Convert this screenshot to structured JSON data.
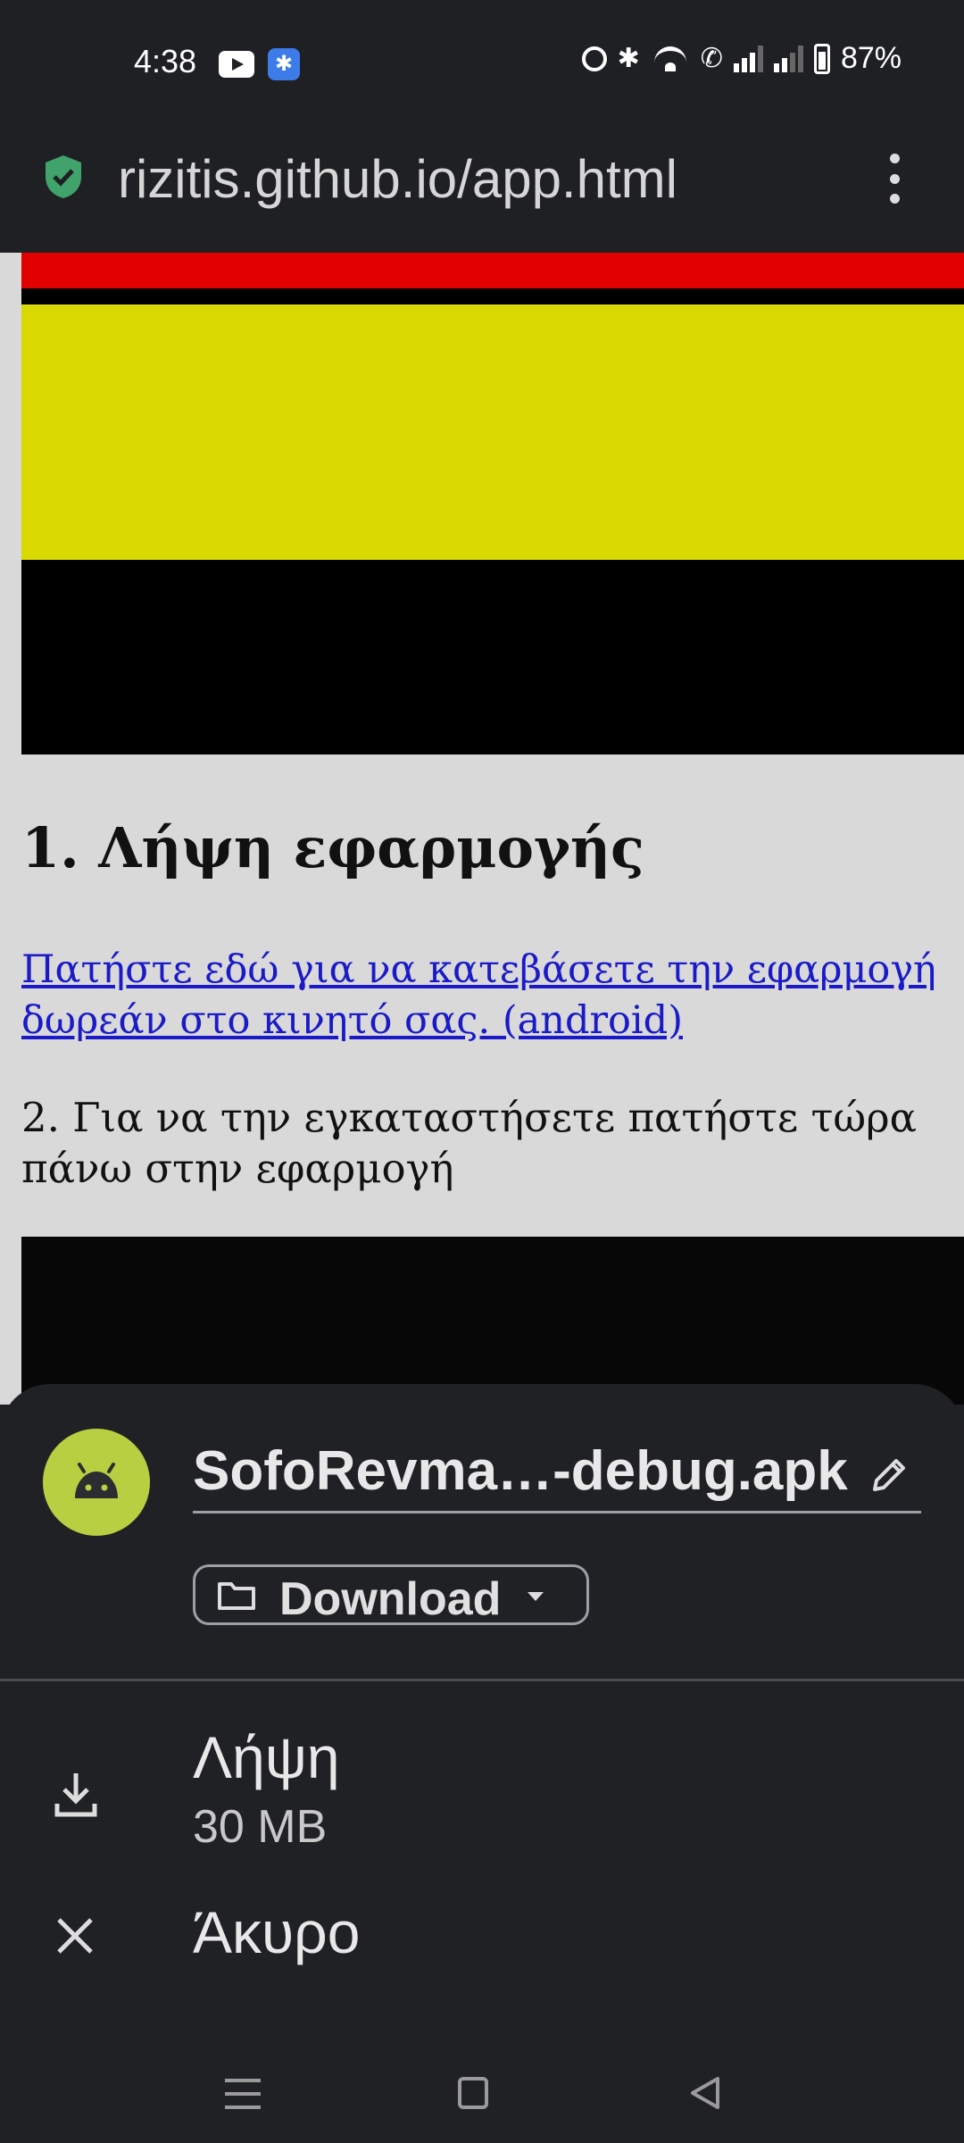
{
  "status_bar": {
    "time": "4:38",
    "battery": "87%",
    "icons": [
      "youtube-icon",
      "bluetooth-app-icon",
      "alarm-icon",
      "bluetooth-icon",
      "wifi-icon",
      "wifi-call-icon",
      "signal-icon",
      "signal-icon-2",
      "battery-icon"
    ]
  },
  "browser": {
    "url": "rizitis.github.io/app.html",
    "secure_icon": "shield-check-icon",
    "menu_icon": "more-vert-icon"
  },
  "page": {
    "heading": "1. Λήψη εφαρμογής",
    "download_link": "Πατήστε εδώ για να κατεβάσετε την εφαρμογή δωρεάν στο κινητό σας. (android)",
    "instruction": "2. Για να την εγκαταστήσετε πατήστε τώρα πάνω στην εφαρμογή",
    "colors": {
      "flag_red": "#e00000",
      "flag_yellow": "#d9d800",
      "flag_black": "#000000",
      "link": "#1a1ac8"
    }
  },
  "download_sheet": {
    "file_name": "SofoRevma…-debug.apk",
    "folder": "Download",
    "download_label": "Λήψη",
    "file_size": "30 MB",
    "cancel_label": "Άκυρο",
    "avatar_color": "#b8cf42"
  },
  "nav_bar": {
    "icons": [
      "recents-icon",
      "home-icon",
      "back-icon"
    ]
  }
}
